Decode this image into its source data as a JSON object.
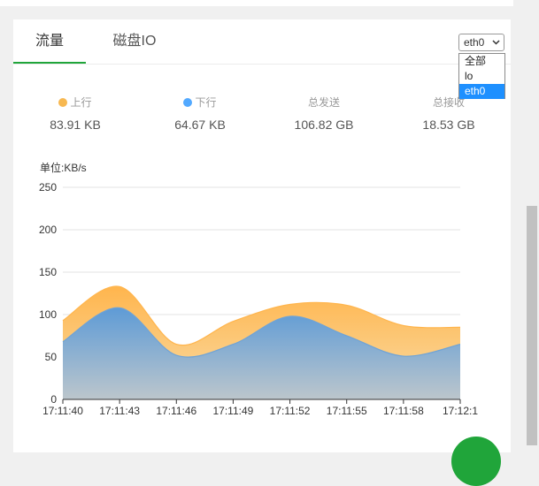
{
  "tabs": [
    {
      "label": "流量"
    },
    {
      "label": "磁盘IO"
    }
  ],
  "interface_select": {
    "value": "eth0",
    "options": [
      "全部",
      "lo",
      "eth0"
    ]
  },
  "stats": {
    "upload": {
      "label": "上行",
      "value": "83.91 KB"
    },
    "download": {
      "label": "下行",
      "value": "64.67 KB"
    },
    "total_sent": {
      "label": "总发送",
      "value": "106.82 GB"
    },
    "total_received": {
      "label": "总接收",
      "value": "18.53 GB"
    }
  },
  "colors": {
    "accent": "#20a53a",
    "upload": "#f7b851",
    "download": "#52a9ff"
  },
  "icons": {
    "select_chevron": "chevron-down-icon"
  },
  "chart_data": {
    "type": "area",
    "ylabel": "单位:KB/s",
    "ylim": [
      0,
      250
    ],
    "yticks": [
      0,
      50,
      100,
      150,
      200,
      250
    ],
    "x": [
      "17:11:40",
      "17:11:43",
      "17:11:46",
      "17:11:49",
      "17:11:52",
      "17:11:55",
      "17:11:58",
      "17:12:1"
    ],
    "series": [
      {
        "name": "上行",
        "values": [
          93,
          133,
          65,
          92,
          112,
          111,
          87,
          85
        ]
      },
      {
        "name": "下行",
        "values": [
          68,
          108,
          52,
          65,
          98,
          75,
          51,
          65
        ]
      }
    ],
    "grid": true
  }
}
